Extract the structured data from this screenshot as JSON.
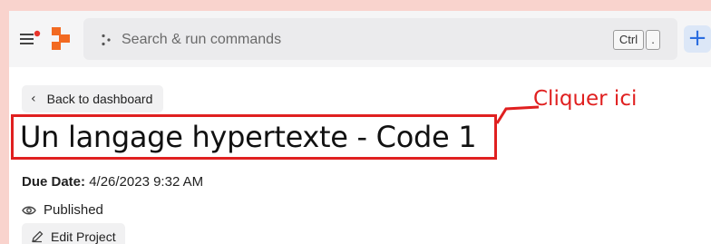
{
  "header": {
    "search_placeholder": "Search & run commands",
    "shortcut_key_1": "Ctrl",
    "shortcut_key_2": ".",
    "add_button_label": "+"
  },
  "nav": {
    "back_label": "Back to dashboard"
  },
  "project": {
    "title": "Un langage hypertexte - Code 1",
    "due_date_label": "Due Date:",
    "due_date_value": "4/26/2023 9:32 AM",
    "status": "Published",
    "edit_label": "Edit Project"
  },
  "annotation": {
    "text": "Cliquer ici",
    "color": "#e02020"
  },
  "icons": {
    "menu": "menu-icon",
    "logo": "app-logo-icon",
    "search": "command-dots-icon",
    "back": "chevron-left-icon",
    "status": "eye-icon",
    "edit": "pencil-icon"
  },
  "colors": {
    "brand": "#f26a22",
    "accent": "#2b6de0",
    "background": "#f9d3cd"
  }
}
